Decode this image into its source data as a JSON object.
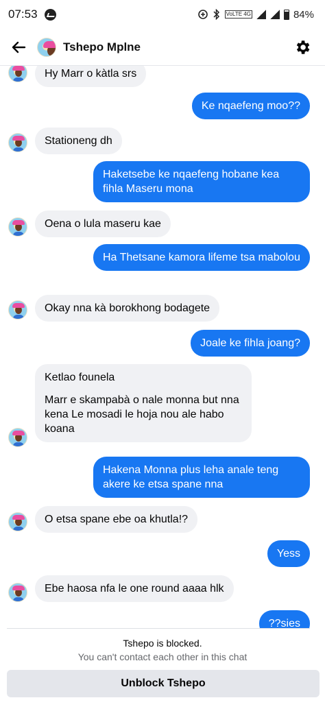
{
  "status_bar": {
    "time": "07:53",
    "network_label": "VoLTE 4G",
    "battery": "84%"
  },
  "header": {
    "contact_name": "Tshepo Mplne"
  },
  "messages": [
    {
      "side": "in",
      "text": "Hy Marr o kàtla srs"
    },
    {
      "side": "out",
      "text": "Ke nqaefeng moo??"
    },
    {
      "side": "in",
      "text": "Stationeng dh"
    },
    {
      "side": "out",
      "text": "Haketsebe ke nqaefeng hobane kea fihla Maseru mona"
    },
    {
      "side": "in",
      "text": "Oena o lula maseru kae"
    },
    {
      "side": "out",
      "text": "Ha Thetsane kamora lifeme tsa mabolou"
    },
    {
      "side": "in",
      "text": "Okay nna kà borokhong bodagete"
    },
    {
      "side": "out",
      "text": "Joale ke fihla joang?"
    },
    {
      "side": "in",
      "text": "Ketlao founela",
      "text2": "Marr e skampabà o nale monna but nna kena Le mosadi le hoja nou ale habo koana"
    },
    {
      "side": "out",
      "text": "Hakena Monna plus leha anale teng akere ke etsa spane nna"
    },
    {
      "side": "in",
      "text": "O etsa  spane ebe oa khutla!?"
    },
    {
      "side": "out",
      "text": "Yess"
    },
    {
      "side": "in",
      "text": "Ebe haosa nfa le one round aaaa hlk"
    },
    {
      "side": "out",
      "text": "??sies"
    }
  ],
  "footer": {
    "blocked_title": "Tshepo is blocked.",
    "blocked_subtitle": "You can't contact each other in this chat",
    "unblock_label": "Unblock Tshepo"
  },
  "colors": {
    "outgoing_bubble": "#1877f2",
    "incoming_bubble": "#f0f1f4",
    "button_bg": "#e4e6eb"
  },
  "icons": [
    "messenger-icon",
    "back-arrow-icon",
    "gear-icon",
    "avatar"
  ]
}
